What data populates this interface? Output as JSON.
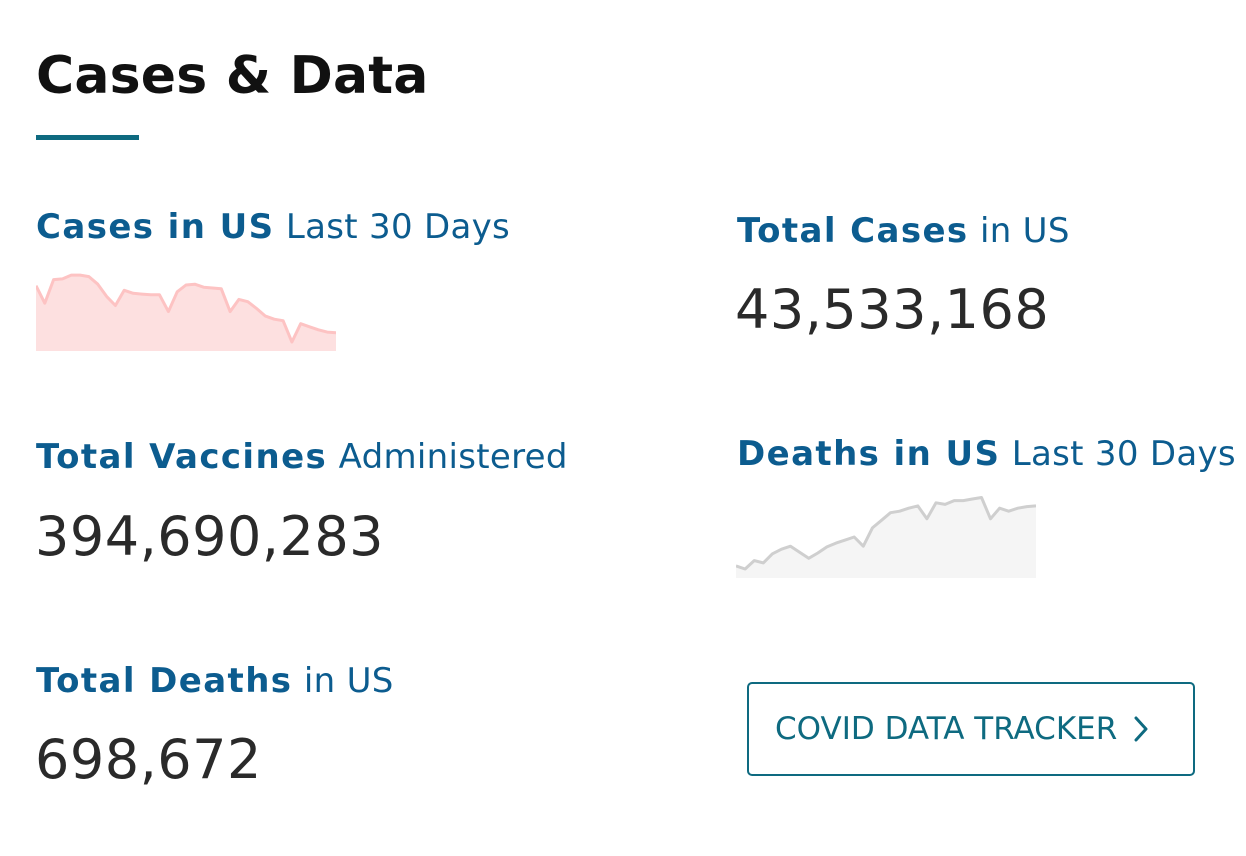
{
  "section": {
    "title": "Cases & Data"
  },
  "cases_us": {
    "label_strong": "Cases in US",
    "label_light": "Last 30 Days",
    "trend_points": [
      0.78,
      0.55,
      0.86,
      0.87,
      0.92,
      0.92,
      0.9,
      0.8,
      0.64,
      0.52,
      0.72,
      0.68,
      0.67,
      0.66,
      0.66,
      0.44,
      0.7,
      0.79,
      0.8,
      0.76,
      0.75,
      0.74,
      0.44,
      0.6,
      0.57,
      0.48,
      0.38,
      0.34,
      0.32,
      0.04,
      0.28,
      0.24,
      0.2,
      0.17,
      0.16
    ],
    "colors": {
      "line": "#fdc3c3",
      "fill": "#fde0e0"
    }
  },
  "total_cases": {
    "label_strong": "Total Cases",
    "label_light": "in US",
    "value": "43,533,168"
  },
  "total_vaccines": {
    "label_strong": "Total Vaccines",
    "label_light": "Administered",
    "value": "394,690,283"
  },
  "deaths_us": {
    "label_strong": "Deaths in US",
    "label_light": "Last 30 Days",
    "trend_points": [
      0.08,
      0.04,
      0.15,
      0.12,
      0.24,
      0.3,
      0.34,
      0.26,
      0.18,
      0.25,
      0.33,
      0.38,
      0.42,
      0.46,
      0.34,
      0.58,
      0.68,
      0.78,
      0.8,
      0.84,
      0.87,
      0.7,
      0.91,
      0.89,
      0.94,
      0.94,
      0.96,
      0.98,
      0.7,
      0.84,
      0.8,
      0.84,
      0.86,
      0.87
    ],
    "colors": {
      "line": "#cfcfcf",
      "fill": "#f5f5f5"
    }
  },
  "total_deaths": {
    "label_strong": "Total Deaths",
    "label_light": "in US",
    "value": "698,672"
  },
  "tracker_button": {
    "label": "COVID DATA TRACKER",
    "icon": "chevron-right-icon"
  },
  "colors": {
    "heading": "#111111",
    "accent": "#0e6a80",
    "label": "#0c5c8f",
    "value": "#2a2a2a"
  }
}
